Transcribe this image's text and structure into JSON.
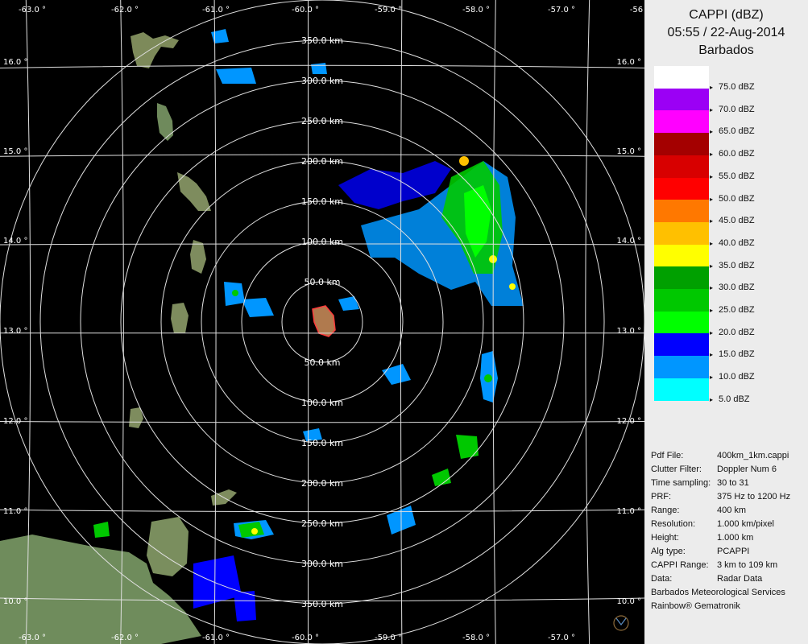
{
  "panel": {
    "title": "CAPPI (dBZ)",
    "datetime": "05:55 / 22-Aug-2014",
    "station": "Barbados"
  },
  "legend": [
    {
      "color": "#ffffff",
      "label": "75.0 dBZ"
    },
    {
      "color": "#9b00f5",
      "label": "70.0 dBZ"
    },
    {
      "color": "#ff00ff",
      "label": "65.0 dBZ"
    },
    {
      "color": "#a40000",
      "label": "60.0 dBZ"
    },
    {
      "color": "#d80000",
      "label": "55.0 dBZ"
    },
    {
      "color": "#ff0000",
      "label": "50.0 dBZ"
    },
    {
      "color": "#ff7800",
      "label": "45.0 dBZ"
    },
    {
      "color": "#ffc000",
      "label": "40.0 dBZ"
    },
    {
      "color": "#ffff00",
      "label": "35.0 dBZ"
    },
    {
      "color": "#00a000",
      "label": "30.0 dBZ"
    },
    {
      "color": "#00c800",
      "label": "25.0 dBZ"
    },
    {
      "color": "#00ff00",
      "label": "20.0 dBZ"
    },
    {
      "color": "#0000ff",
      "label": "15.0 dBZ"
    },
    {
      "color": "#0096ff",
      "label": "10.0 dBZ"
    },
    {
      "color": "#00ffff",
      "label": "5.0 dBZ"
    }
  ],
  "info": {
    "rows": [
      {
        "key": "Pdf File:",
        "value": "400km_1km.cappi"
      },
      {
        "key": "Clutter Filter:",
        "value": "Doppler Num 6"
      },
      {
        "key": "Time sampling:",
        "value": "30 to 31"
      },
      {
        "key": "PRF:",
        "value": "375 Hz to 1200 Hz"
      },
      {
        "key": "Range:",
        "value": "400 km"
      },
      {
        "key": "Resolution:",
        "value": "1.000 km/pixel"
      },
      {
        "key": "Height:",
        "value": "1.000 km"
      },
      {
        "key": "Alg type:",
        "value": "PCAPPI"
      },
      {
        "key": "CAPPI Range:",
        "value": "3 km to 109 km"
      },
      {
        "key": "Data:",
        "value": "Radar Data"
      }
    ],
    "organization": "Barbados Meteorological Services",
    "software": "Rainbow® Gematronik"
  },
  "map": {
    "longitude_labels": [
      "-63.0 °",
      "-62.0 °",
      "-61.0 °",
      "-60.0 °",
      "-59.0 °",
      "-58.0 °",
      "-57.0 °",
      "-56"
    ],
    "latitude_labels": [
      "16.0 °",
      "15.0 °",
      "14.0 °",
      "13.0 °",
      "12.0 °",
      "11.0 °",
      "10.0 °"
    ],
    "range_labels_north": [
      "50.0 km",
      "100.0 km",
      "150.0 km",
      "200.0 km",
      "250.0 km",
      "300.0 km",
      "350.0 km"
    ],
    "range_labels_south": [
      "50.0 km",
      "100.0 km",
      "150.0 km",
      "200.0 km",
      "250.0 km",
      "300.0 km",
      "350.0 km"
    ],
    "range_rings_km": [
      50,
      100,
      150,
      200,
      250,
      300,
      350,
      400
    ]
  }
}
